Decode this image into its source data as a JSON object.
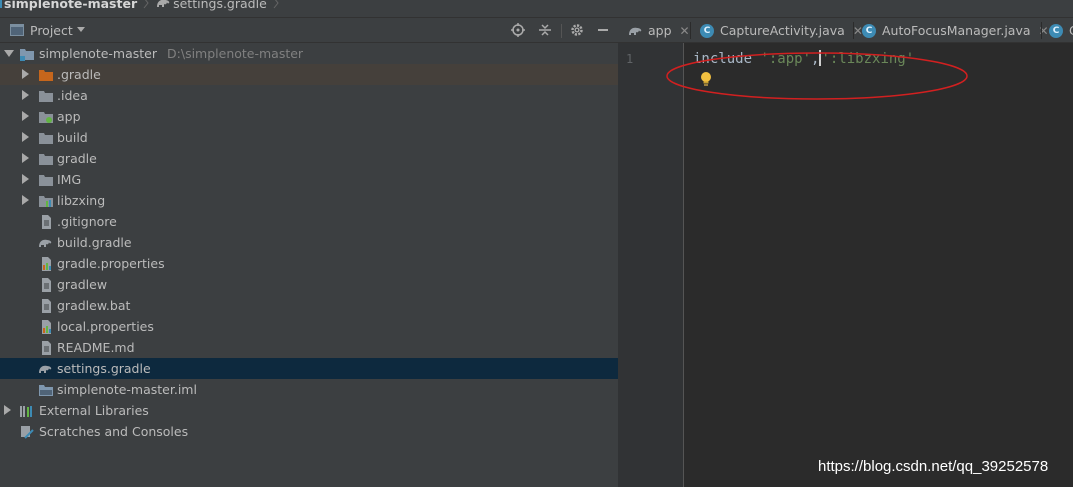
{
  "breadcrumb": {
    "root": "simplenote-master",
    "file": "settings.gradle"
  },
  "project_panel": {
    "title": "Project",
    "icons": [
      "project-icon",
      "locate-icon",
      "collapse-icon",
      "settings-icon",
      "hide-icon"
    ]
  },
  "tree": {
    "root": {
      "name": "simplenote-master",
      "path": "D:\\simplenote-master"
    },
    "children": [
      {
        "name": ".gradle",
        "icon": "folder-orange-icon"
      },
      {
        "name": ".idea",
        "icon": "folder-icon"
      },
      {
        "name": "app",
        "icon": "module-folder-icon"
      },
      {
        "name": "build",
        "icon": "folder-icon"
      },
      {
        "name": "gradle",
        "icon": "folder-icon"
      },
      {
        "name": "IMG",
        "icon": "folder-icon"
      },
      {
        "name": "libzxing",
        "icon": "library-folder-icon"
      },
      {
        "name": ".gitignore",
        "icon": "file-icon"
      },
      {
        "name": "build.gradle",
        "icon": "gradle-icon"
      },
      {
        "name": "gradle.properties",
        "icon": "properties-icon"
      },
      {
        "name": "gradlew",
        "icon": "file-icon"
      },
      {
        "name": "gradlew.bat",
        "icon": "file-icon"
      },
      {
        "name": "local.properties",
        "icon": "properties-icon"
      },
      {
        "name": "README.md",
        "icon": "file-icon"
      },
      {
        "name": "settings.gradle",
        "icon": "gradle-icon"
      },
      {
        "name": "simplenote-master.iml",
        "icon": "iml-icon"
      }
    ],
    "external_libraries": "External Libraries",
    "scratches": "Scratches and Consoles"
  },
  "editor": {
    "tabs": [
      {
        "label": "app",
        "icon": "gradle-icon"
      },
      {
        "label": "CaptureActivity.java",
        "icon": "java-class-icon"
      },
      {
        "label": "AutoFocusManager.java",
        "icon": "java-class-icon"
      },
      {
        "label": "C",
        "icon": "java-class-icon"
      }
    ],
    "line_number": "1",
    "code": {
      "keyword": "include ",
      "str1": "':app'",
      "comma": ",",
      "str2": "':libzxing'"
    },
    "annotation_color": "#d22020"
  },
  "watermark": "https://blog.csdn.net/qq_39252578",
  "colors": {
    "panel_bg": "#3c3f41",
    "editor_bg": "#2b2b2b",
    "selected_row": "#0d293e",
    "string": "#6a8759"
  }
}
